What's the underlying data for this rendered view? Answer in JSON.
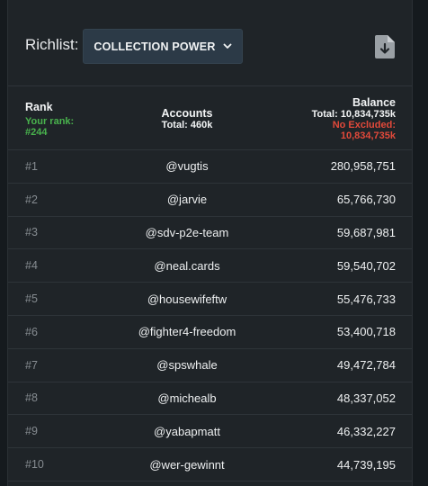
{
  "header": {
    "label": "Richlist:",
    "dropdown_label": "COLLECTION POWER",
    "download_icon": "file-download-icon"
  },
  "table": {
    "rank_header": "Rank",
    "your_rank_label": "Your rank:",
    "your_rank_value": "#244",
    "accounts_header": "Accounts",
    "accounts_total": "Total: 460k",
    "balance_header": "Balance",
    "balance_total": "Total: 10,834,735k",
    "no_excluded_label": "No Excluded:",
    "no_excluded_value": "10,834,735k",
    "rows": [
      {
        "rank": "#1",
        "account": "@vugtis",
        "balance": "280,958,751"
      },
      {
        "rank": "#2",
        "account": "@jarvie",
        "balance": "65,766,730"
      },
      {
        "rank": "#3",
        "account": "@sdv-p2e-team",
        "balance": "59,687,981"
      },
      {
        "rank": "#4",
        "account": "@neal.cards",
        "balance": "59,540,702"
      },
      {
        "rank": "#5",
        "account": "@housewifeftw",
        "balance": "55,476,733"
      },
      {
        "rank": "#6",
        "account": "@fighter4-freedom",
        "balance": "53,400,718"
      },
      {
        "rank": "#7",
        "account": "@spswhale",
        "balance": "49,472,784"
      },
      {
        "rank": "#8",
        "account": "@michealb",
        "balance": "48,337,052"
      },
      {
        "rank": "#9",
        "account": "@yabapmatt",
        "balance": "46,332,227"
      },
      {
        "rank": "#10",
        "account": "@wer-gewinnt",
        "balance": "44,739,195"
      }
    ]
  },
  "colors": {
    "background": "#1f2428",
    "accent_green": "#49b34d",
    "accent_red": "#e2493a",
    "dropdown_bg": "#2c3a47"
  }
}
